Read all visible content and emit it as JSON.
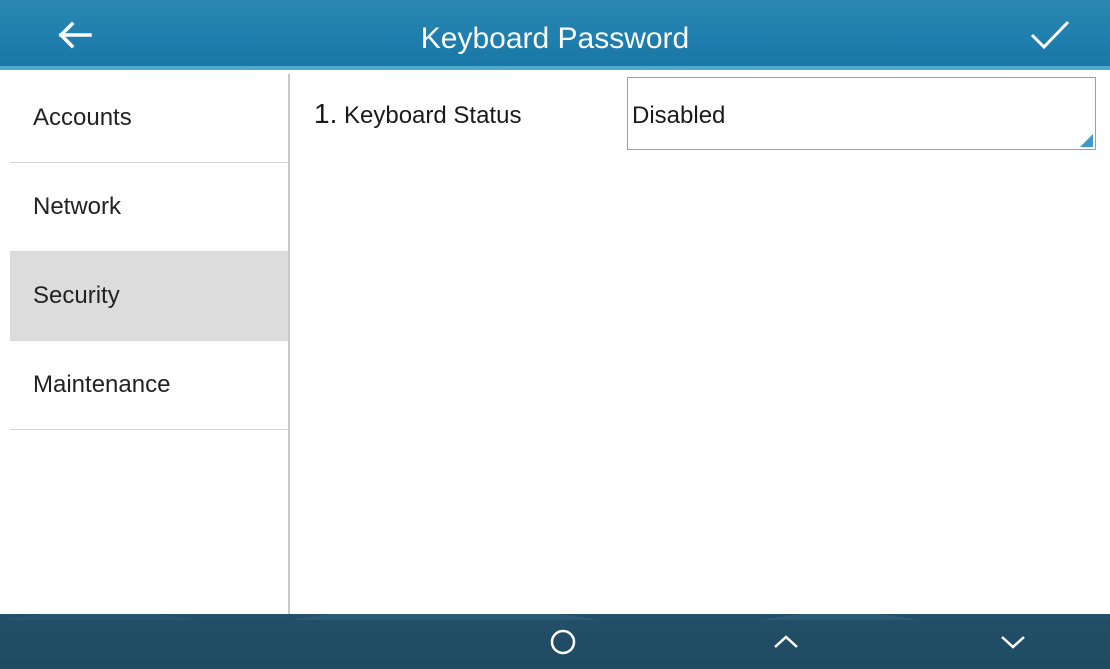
{
  "header": {
    "title": "Keyboard Password",
    "back_icon": "back-arrow-icon",
    "confirm_icon": "checkmark-icon"
  },
  "sidebar": {
    "items": [
      {
        "label": "Accounts",
        "selected": false
      },
      {
        "label": "Network",
        "selected": false
      },
      {
        "label": "Security",
        "selected": true
      },
      {
        "label": "Maintenance",
        "selected": false
      }
    ]
  },
  "settings": [
    {
      "index": "1.",
      "label": "Keyboard Status",
      "value": "Disabled"
    }
  ],
  "footer": {
    "buttons": [
      {
        "icon": "circle-icon"
      },
      {
        "icon": "chevron-up-icon"
      },
      {
        "icon": "chevron-down-icon"
      }
    ]
  },
  "colors": {
    "header": "#1f7fae",
    "header_accent": "#4fa9cf",
    "footer": "#234f68",
    "selected_item": "#dcdcdc",
    "field_border": "#6ab0cf",
    "dropdown_corner": "#3e9bc5"
  }
}
